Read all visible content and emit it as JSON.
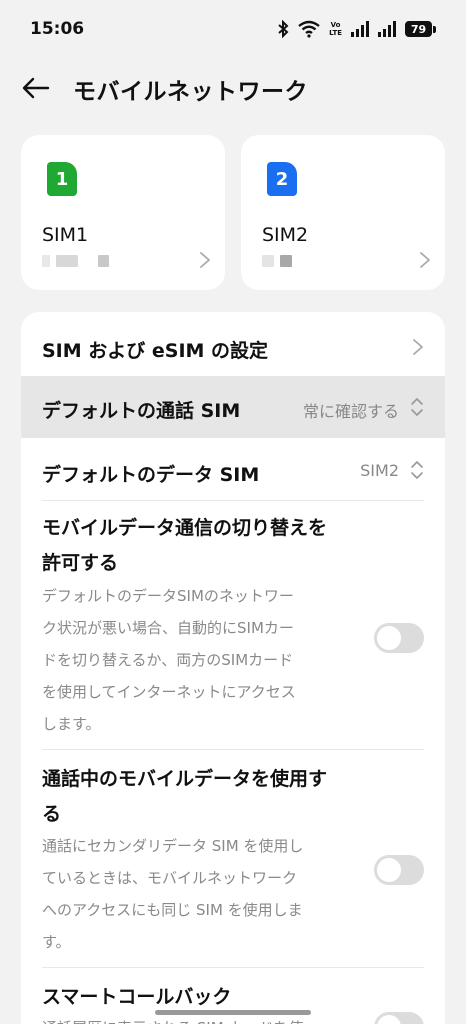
{
  "status_bar": {
    "time": "15:06",
    "battery": "79",
    "volte_top": "Vo",
    "volte_bottom": "LTE"
  },
  "header": {
    "title": "モバイルネットワーク"
  },
  "sim_cards": [
    {
      "badge": "1",
      "name": "SIM1",
      "color": "#1fa832"
    },
    {
      "badge": "2",
      "name": "SIM2",
      "color": "#1a6ef0"
    }
  ],
  "settings": {
    "sim_esim": "SIM および eSIM の設定",
    "default_call_sim": {
      "label": "デフォルトの通話 SIM",
      "value": "常に確認する"
    },
    "default_data_sim": {
      "label": "デフォルトのデータ SIM",
      "value": "SIM2"
    },
    "allow_switch": {
      "title_lines": [
        "モバイルデータ通信の切り替えを",
        "許可する"
      ],
      "desc_lines": [
        "デフォルトのデータSIMのネットワー",
        "ク状況が悪い場合、自動的にSIMカー",
        "ドを切り替えるか、両方のSIMカード",
        "を使用してインターネットにアクセス",
        "します。"
      ],
      "enabled": false
    },
    "data_during_call": {
      "title_lines": [
        "通話中のモバイルデータを使用す",
        "る"
      ],
      "desc_lines": [
        "通話にセカンダリデータ SIM を使用し",
        "ているときは、モバイルネットワーク",
        "へのアクセスにも同じ SIM を使用しま",
        "す。"
      ],
      "enabled": false
    },
    "smart_callback": {
      "title": "スマートコールバック",
      "desc_partial": "通話履歴に表示される SIM カードを使"
    }
  },
  "colors": {
    "background": "#f2f2f2",
    "card": "#ffffff",
    "highlight": "#e6e6e6",
    "secondary_text": "#8a8a8a",
    "toggle_off": "#dcdcdc"
  }
}
